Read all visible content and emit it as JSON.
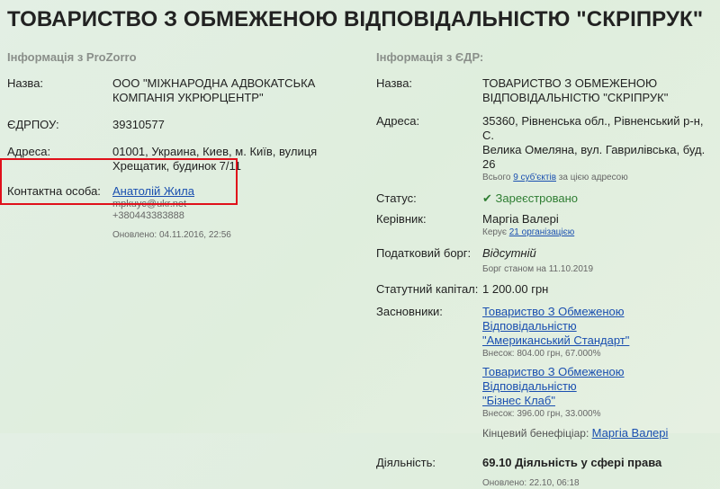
{
  "page": {
    "title": "ТОВАРИСТВО З ОБМЕЖЕНОЮ ВІДПОВІДАЛЬНІСТЮ \"СКРІПРУК\""
  },
  "prozorro": {
    "heading": "Інформація з ProZorro",
    "name_label": "Назва:",
    "name_value_1": "ООО \"МІЖНАРОДНА АДВОКАТСЬКА",
    "name_value_2": "КОМПАНІЯ УКРЮРЦЕНТР\"",
    "edrpou_label": "ЄДРПОУ:",
    "edrpou_value": "39310577",
    "address_label": "Адреса:",
    "address_value_1": "01001, Украина, Киев, м. Київ, вулиця",
    "address_value_2": "Хрещатик, будинок 7/11",
    "contact_label": "Контактна особа:",
    "contact_name": "Анатолій Жила",
    "contact_email": "mpkuyc@ukr.net",
    "contact_phone": "+380443383888",
    "updated": "Оновлено: 04.11.2016, 22:56"
  },
  "edr": {
    "heading": "Інформація з ЄДР:",
    "name_label": "Назва:",
    "name_value_1": "ТОВАРИСТВО З ОБМЕЖЕНОЮ",
    "name_value_2": "ВІДПОВІДАЛЬНІСТЮ \"СКРІПРУК\"",
    "address_label": "Адреса:",
    "address_value_1": "35360, Рівненська обл., Рівненський р-н, С.",
    "address_value_2": "Велика Омеляна, вул. Гаврилівська, буд. 26",
    "address_note_prefix": "Всього",
    "address_note_link": "9 суб'єктів",
    "address_note_suffix": "за цією адресою",
    "status_label": "Статус:",
    "status_check": "✔",
    "status_value": "Зареєстровано",
    "manager_label": "Керівник:",
    "manager_value": "Маргіа Валері",
    "manager_note_prefix": "Керує",
    "manager_note_link": "21 організацією",
    "tax_label": "Податковий борг:",
    "tax_value": "Відсутній",
    "tax_note": "Борг станом на 11.10.2019",
    "capital_label": "Статутний капітал:",
    "capital_value": "1 200.00 грн",
    "founders_label": "Засновники:",
    "founder1_link_1": "Товариство З Обмеженою Відповідальністю",
    "founder1_link_2": "\"Американський Стандарт\"",
    "founder1_note": "Внесок: 804.00 грн, 67.000%",
    "founder2_link_1": "Товариство З Обмеженою Відповідальністю",
    "founder2_link_2": "\"Бізнес Клаб\"",
    "founder2_note": "Внесок: 396.00 грн, 33.000%",
    "beneficiary_label": "Кінцевий бенефіціар:",
    "beneficiary_link": "Маргіа Валері",
    "activity_label": "Діяльність:",
    "activity_value": "69.10 Діяльність у сфері права",
    "updated": "Оновлено: 22.10, 06:18"
  }
}
